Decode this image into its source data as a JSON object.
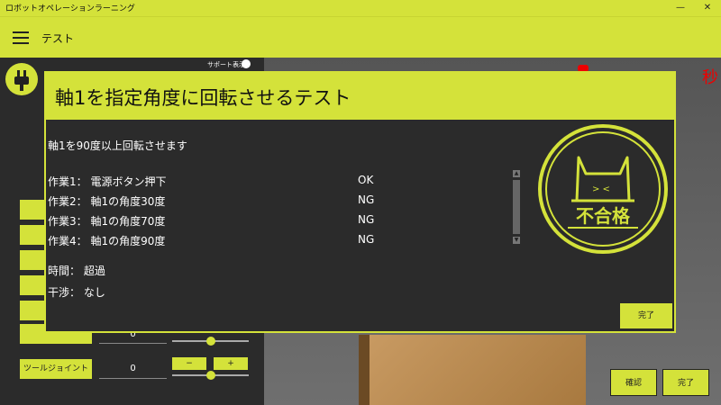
{
  "window": {
    "title": "ロボットオペレーションラーニング",
    "minimize": "—",
    "close": "✕"
  },
  "header": {
    "title": "テスト"
  },
  "support": {
    "label": "サポート表示"
  },
  "controls": {
    "tool_joint_label": "ツールジョイント",
    "tool_joint_value": "0",
    "partial_value": "0",
    "minus": "−",
    "plus": "+"
  },
  "viewport": {
    "timer_unit": "秒"
  },
  "bottom_buttons": {
    "confirm": "確認",
    "done": "完了"
  },
  "dialog": {
    "title": "軸1を指定角度に回転させるテスト",
    "description": "軸1を90度以上回転させます",
    "tasks": [
      {
        "label": "作業1： 電源ボタン押下",
        "result": "OK"
      },
      {
        "label": "作業2： 軸1の角度30度",
        "result": "NG"
      },
      {
        "label": "作業3： 軸1の角度70度",
        "result": "NG"
      },
      {
        "label": "作業4： 軸1の角度90度",
        "result": "NG"
      }
    ],
    "time_label": "時間：",
    "time_value": "超過",
    "interference_label": "干渉：",
    "interference_value": "なし",
    "stamp_text": "不合格",
    "done_label": "完了"
  },
  "colors": {
    "accent": "#d4e23a",
    "panel": "#2b2b2b",
    "danger": "#e00000"
  },
  "icons": {
    "menu": "hamburger-icon",
    "power": "plug-icon",
    "stamp": "cat-fail-stamp-icon"
  }
}
